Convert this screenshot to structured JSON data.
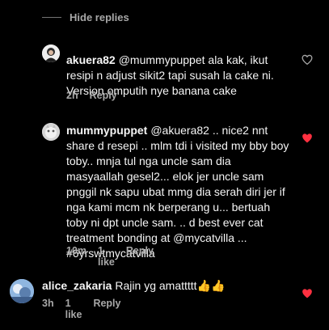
{
  "header": {
    "hide_replies_label": "Hide replies"
  },
  "comments": [
    {
      "username": "akuera82",
      "text": "@mummypuppet ala kak, ikut resipi n adjust sikit2 tapi susah la cake ni. Version omputih nye banana cake",
      "time": "2h",
      "likes": "",
      "reply_label": "Reply",
      "liked": false
    },
    {
      "username": "mummypuppet",
      "text": "@akuera82 .. nice2 nnt share d resepi .. mlm tdi i visited my bby boy toby.. mnja tul nga uncle sam dia masyaallah gesel2... elok jer uncle sam pnggil  nk sapu ubat mmg dia serah diri jer if nga kami  mcm nk berperang  u... bertuah toby ni dpt uncle sam. .. d best ever cat treatment bonding at @mycatvilla ... #6yrswtmycatvilla",
      "time": "10m",
      "likes": "1 like",
      "reply_label": "Reply",
      "liked": true
    },
    {
      "username": "alice_zakaria",
      "text": "Rajin yg amattttt👍👍",
      "time": "3h",
      "likes": "1 like",
      "reply_label": "Reply",
      "liked": true
    }
  ],
  "colors": {
    "background": "#000000",
    "text": "#f5f5f5",
    "secondary": "#a8a8a8",
    "heart_liked": "#ff3040"
  },
  "icons": [
    "heart-icon",
    "heart-filled-icon"
  ]
}
